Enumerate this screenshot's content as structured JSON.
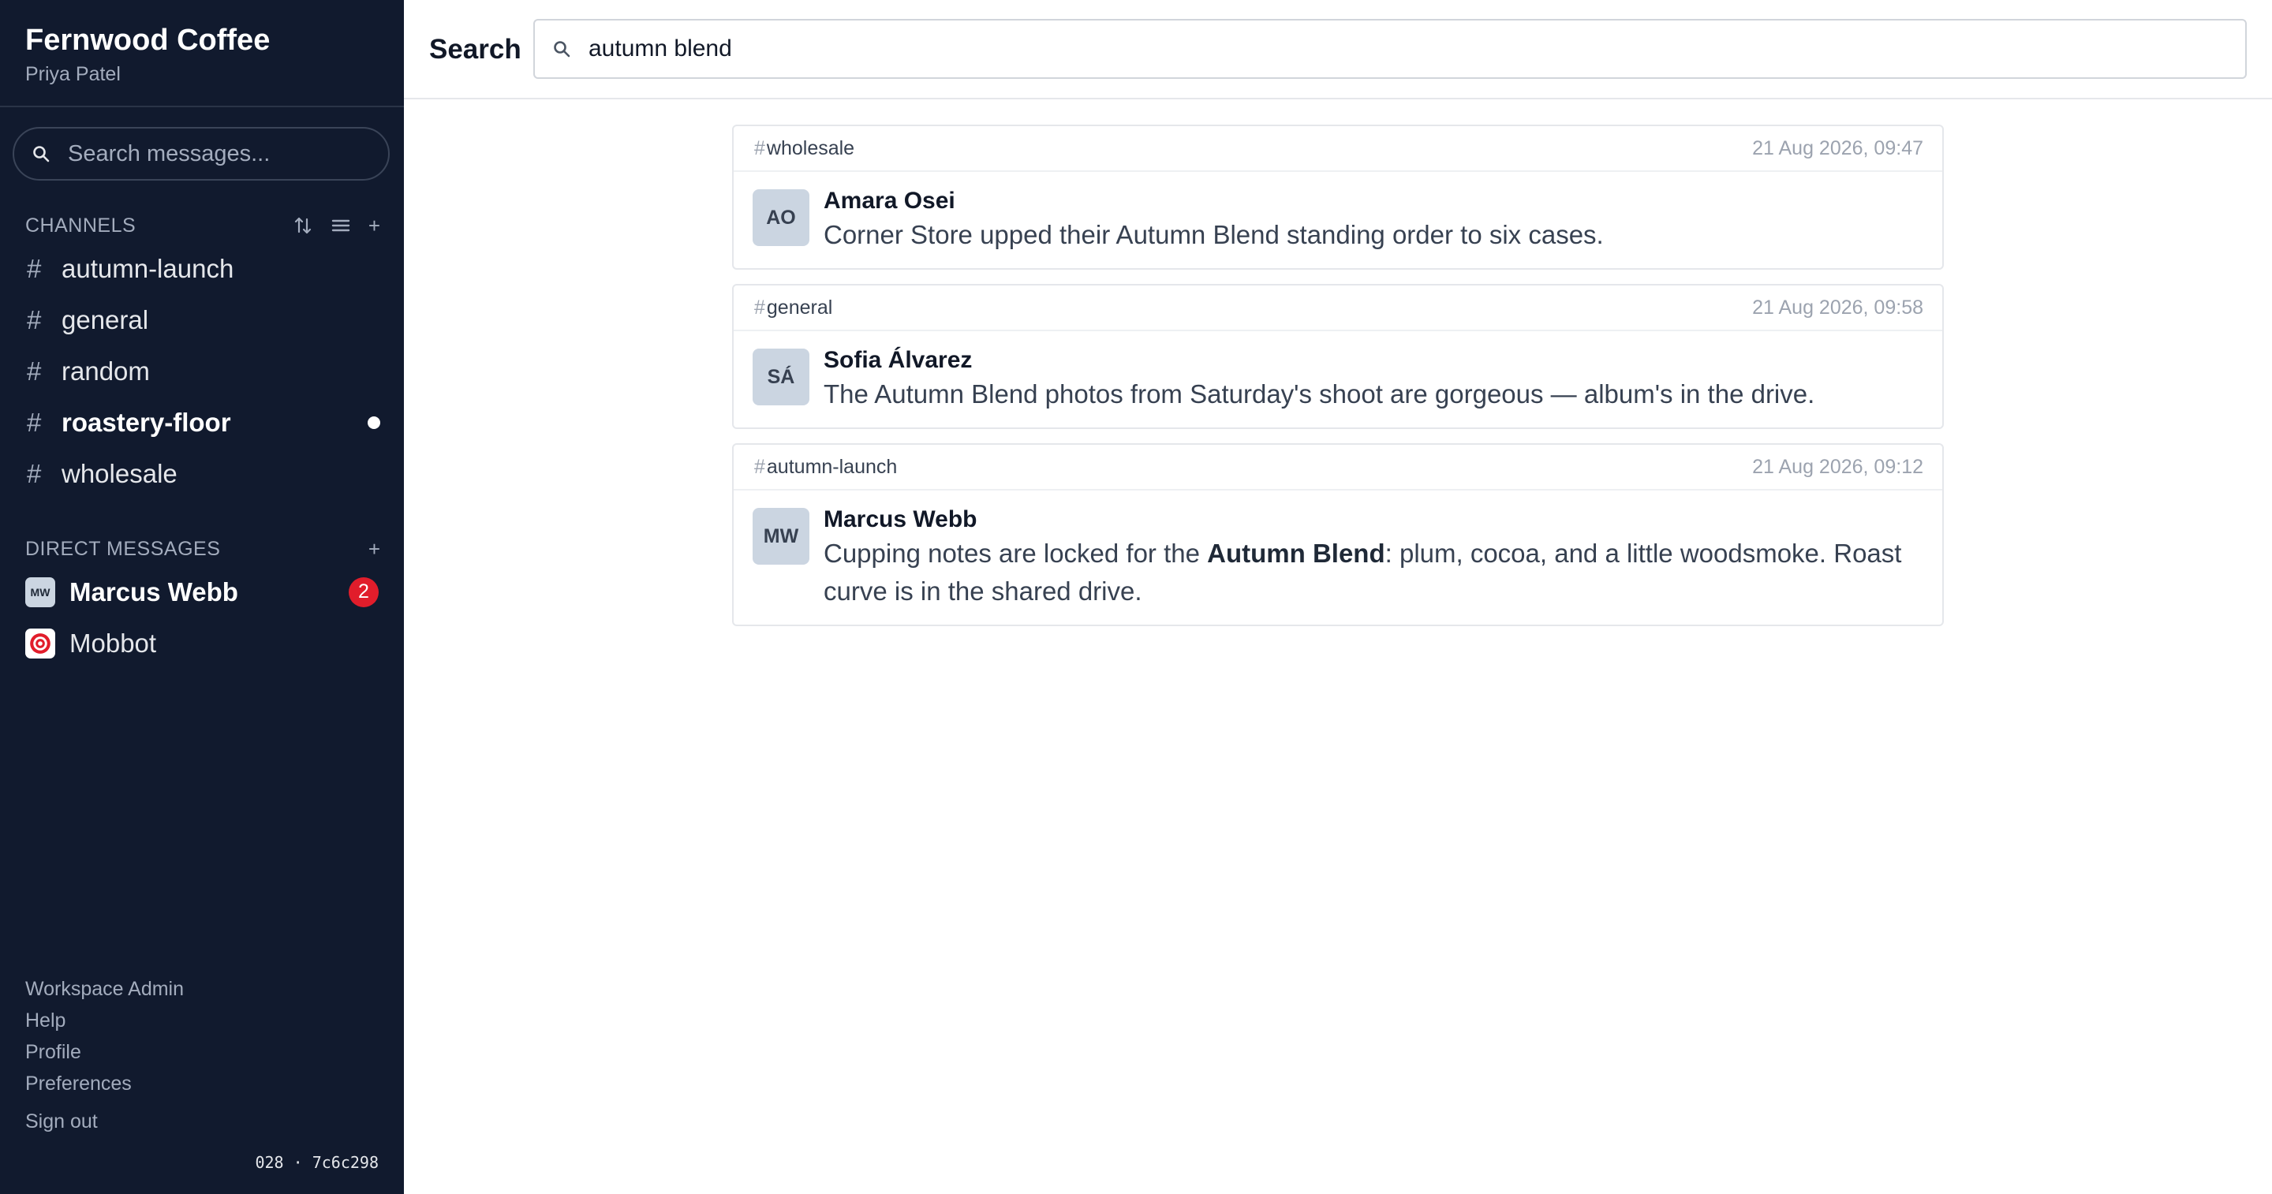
{
  "workspace": {
    "name": "Fernwood Coffee",
    "user": "Priya Patel"
  },
  "sidebar_search": {
    "placeholder": "Search messages..."
  },
  "channels_section": {
    "label": "CHANNELS",
    "sort_icon": "sort-arrows-icon",
    "list_icon": "list-icon",
    "add": "+"
  },
  "channels": [
    {
      "name": "autumn-launch",
      "unread": false
    },
    {
      "name": "general",
      "unread": false
    },
    {
      "name": "random",
      "unread": false
    },
    {
      "name": "roastery-floor",
      "unread": true
    },
    {
      "name": "wholesale",
      "unread": false
    }
  ],
  "dm_section": {
    "label": "DIRECT MESSAGES",
    "add": "+"
  },
  "dms": [
    {
      "name": "Marcus Webb",
      "initials": "MW",
      "badge": "2"
    },
    {
      "name": "Mobbot",
      "icon": "target-icon"
    }
  ],
  "footer": {
    "links": [
      "Workspace Admin",
      "Help",
      "Profile",
      "Preferences"
    ],
    "signout": "Sign out",
    "build": "028 · 7c6c298"
  },
  "main": {
    "title": "Search",
    "query": "autumn blend"
  },
  "results": [
    {
      "channel": "wholesale",
      "time": "21 Aug 2026, 09:47",
      "initials": "AO",
      "author": "Amara Osei",
      "text": "Corner Store upped their Autumn Blend standing order to six cases."
    },
    {
      "channel": "general",
      "time": "21 Aug 2026, 09:58",
      "initials": "SÁ",
      "author": "Sofia Álvarez",
      "text": "The Autumn Blend photos from Saturday's shoot are gorgeous — album's in the drive."
    },
    {
      "channel": "autumn-launch",
      "time": "21 Aug 2026, 09:12",
      "initials": "MW",
      "author": "Marcus Webb",
      "text_before": "Cupping notes are locked for the ",
      "text_bold": "Autumn Blend",
      "text_after": ": plum, cocoa, and a little woodsmoke. Roast curve is in the shared drive."
    }
  ],
  "colors": {
    "sidebar_bg": "#111a2e",
    "badge": "#e11d2b",
    "avatar_bg": "#cbd5e1",
    "bot_red": "#e11d2b"
  }
}
